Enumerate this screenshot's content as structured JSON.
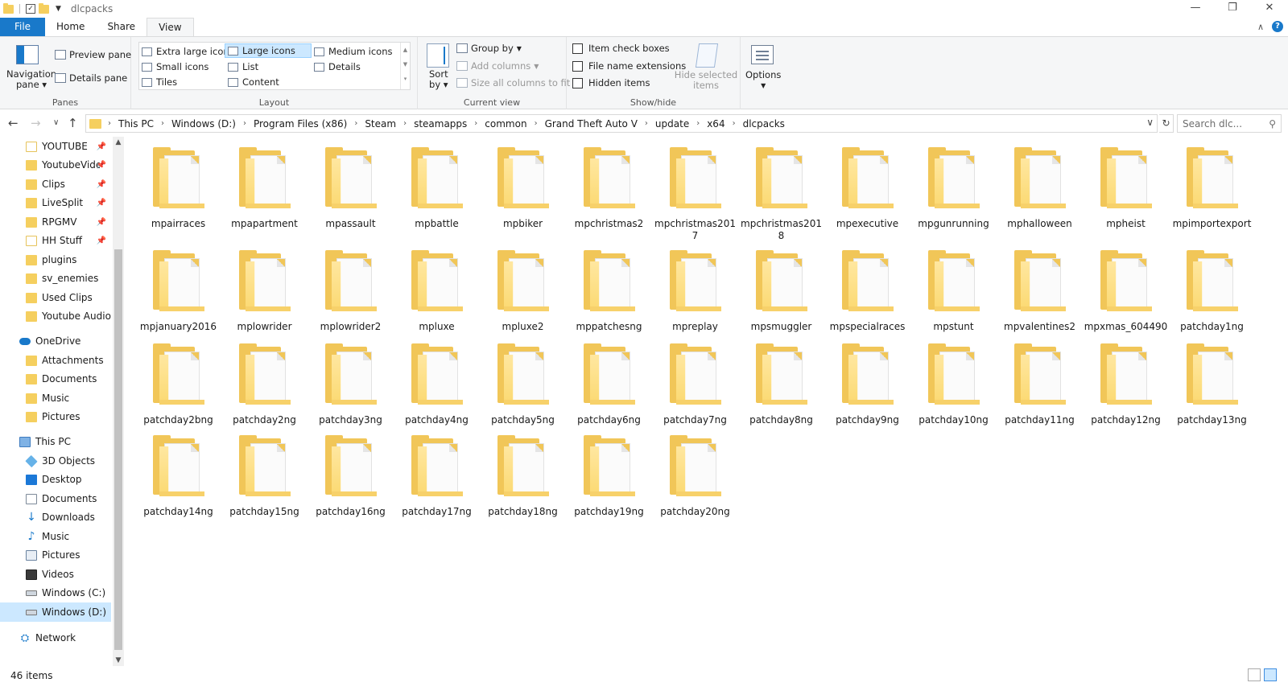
{
  "window": {
    "title": "dlcpacks",
    "controls": {
      "minimize": "—",
      "maximize": "❐",
      "close": "✕"
    }
  },
  "ribbon_tabs": [
    "File",
    "Home",
    "Share",
    "View"
  ],
  "ribbon": {
    "panes": {
      "label": "Panes",
      "navigation_pane": "Navigation",
      "navigation_pane_2": "pane",
      "preview_pane": "Preview pane",
      "details_pane": "Details pane"
    },
    "layout": {
      "label": "Layout",
      "items": [
        "Extra large icons",
        "Large icons",
        "Medium icons",
        "Small icons",
        "List",
        "Details",
        "Tiles",
        "Content"
      ],
      "selected": "Large icons"
    },
    "current_view": {
      "label": "Current view",
      "sort_by": "Sort",
      "sort_by_2": "by",
      "group_by": "Group by",
      "add_columns": "Add columns",
      "size_columns": "Size all columns to fit"
    },
    "show_hide": {
      "label": "Show/hide",
      "item_check_boxes": "Item check boxes",
      "file_name_extensions": "File name extensions",
      "hidden_items": "Hidden items",
      "hide_selected": "Hide selected",
      "hide_selected_2": "items"
    },
    "options": "Options"
  },
  "address": {
    "crumbs": [
      "This PC",
      "Windows (D:)",
      "Program Files (x86)",
      "Steam",
      "steamapps",
      "common",
      "Grand Theft Auto V",
      "update",
      "x64",
      "dlcpacks"
    ],
    "search_placeholder": "Search dlc..."
  },
  "nav": {
    "quick_access": [
      {
        "label": "YOUTUBE",
        "pinned": true
      },
      {
        "label": "YoutubeVideos",
        "pinned": true
      },
      {
        "label": "Clips",
        "pinned": true
      },
      {
        "label": "LiveSplit",
        "pinned": true
      },
      {
        "label": "RPGMV",
        "pinned": true
      },
      {
        "label": "HH Stuff",
        "pinned": true
      },
      {
        "label": "plugins",
        "pinned": false
      },
      {
        "label": "sv_enemies",
        "pinned": false
      },
      {
        "label": "Used Clips",
        "pinned": false
      },
      {
        "label": "Youtube Audios",
        "pinned": false
      }
    ],
    "onedrive": "OneDrive",
    "onedrive_items": [
      "Attachments",
      "Documents",
      "Music",
      "Pictures"
    ],
    "this_pc": "This PC",
    "this_pc_items": [
      "3D Objects",
      "Desktop",
      "Documents",
      "Downloads",
      "Music",
      "Pictures",
      "Videos",
      "Windows (C:)",
      "Windows (D:)"
    ],
    "network": "Network",
    "selected": "Windows (D:)"
  },
  "folders": [
    "mpairraces",
    "mpapartment",
    "mpassault",
    "mpbattle",
    "mpbiker",
    "mpchristmas2",
    "mpchristmas2017",
    "mpchristmas2018",
    "mpexecutive",
    "mpgunrunning",
    "mphalloween",
    "mpheist",
    "mpimportexport",
    "mpjanuary2016",
    "mplowrider",
    "mplowrider2",
    "mpluxe",
    "mpluxe2",
    "mppatchesng",
    "mpreplay",
    "mpsmuggler",
    "mpspecialraces",
    "mpstunt",
    "mpvalentines2",
    "mpxmas_604490",
    "patchday1ng",
    "patchday2bng",
    "patchday2ng",
    "patchday3ng",
    "patchday4ng",
    "patchday5ng",
    "patchday6ng",
    "patchday7ng",
    "patchday8ng",
    "patchday9ng",
    "patchday10ng",
    "patchday11ng",
    "patchday12ng",
    "patchday13ng",
    "patchday14ng",
    "patchday15ng",
    "patchday16ng",
    "patchday17ng",
    "patchday18ng",
    "patchday19ng",
    "patchday20ng"
  ],
  "status": {
    "count": "46 items"
  }
}
